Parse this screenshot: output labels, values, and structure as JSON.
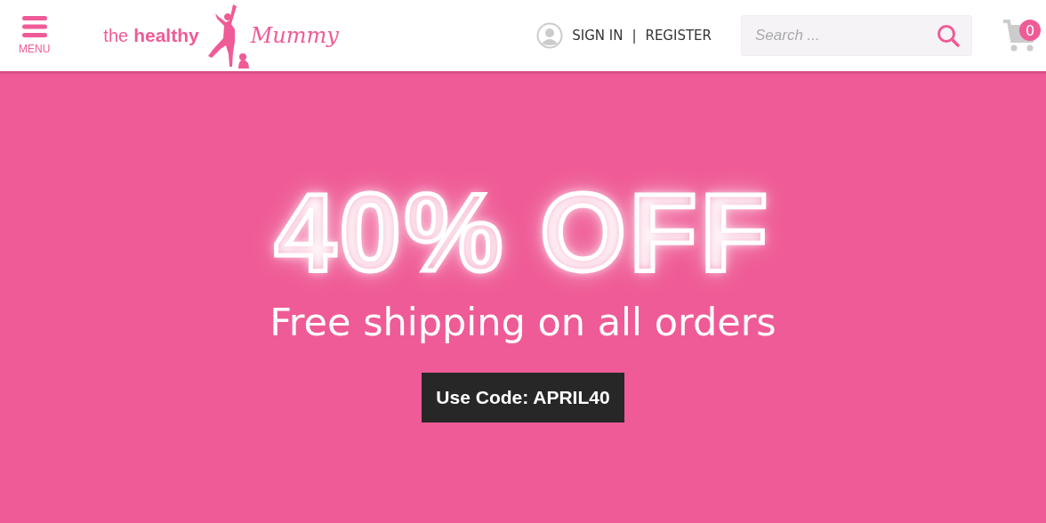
{
  "header": {
    "menu_label": "MENU",
    "logo": {
      "word_1": "the",
      "word_2": "healthy",
      "word_3": "Mummy"
    },
    "sign_in": "SIGN IN",
    "separator": "|",
    "register": "REGISTER",
    "search": {
      "placeholder": "Search ..."
    },
    "cart_count": "0"
  },
  "hero": {
    "headline": "40% OFF",
    "subheadline": "Free shipping on all orders",
    "code_label": "Use Code: APRIL40"
  }
}
